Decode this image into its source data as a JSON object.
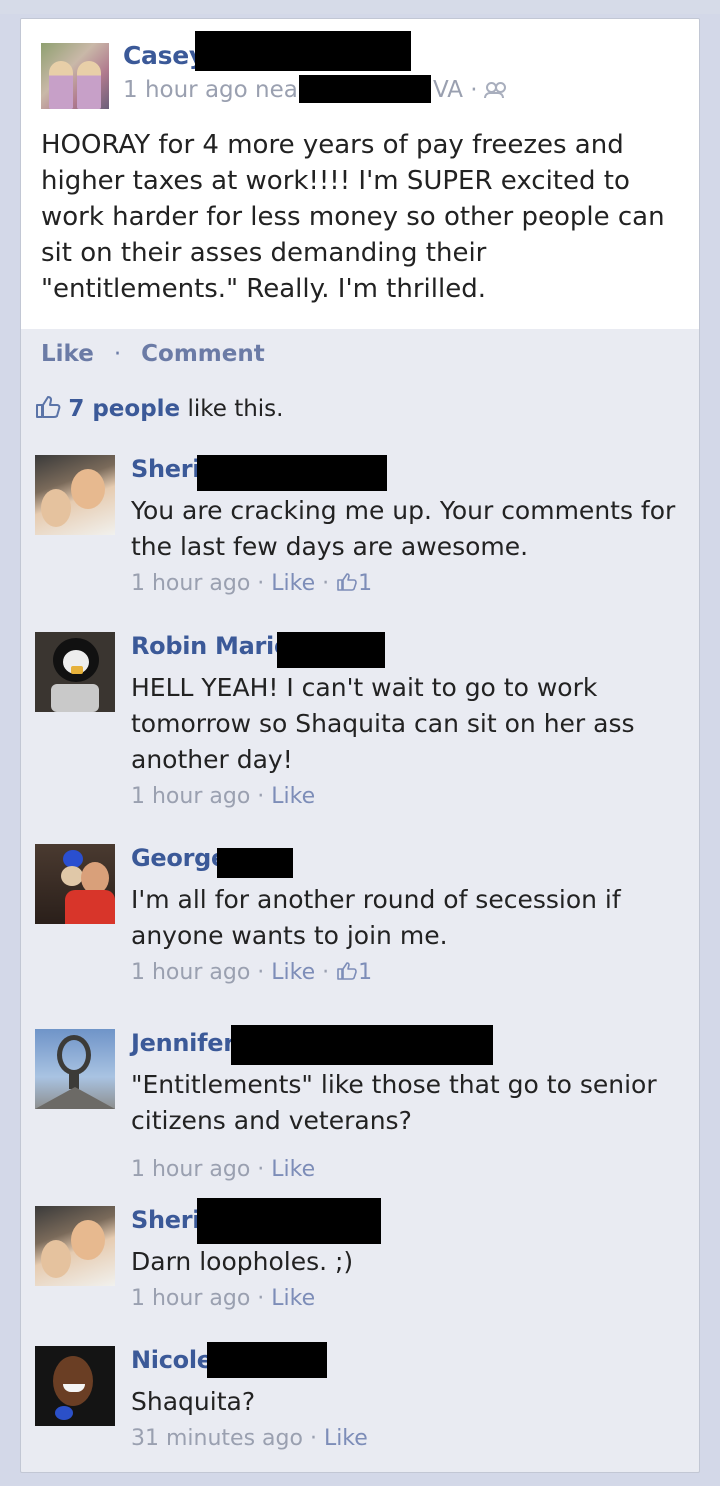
{
  "post": {
    "author": "Casey",
    "time": "1 hour ago near",
    "location_suffix": "VA ·",
    "privacy_icon": "friends-icon",
    "text": "HOORAY for 4 more years of pay freezes and higher taxes at work!!!! I'm SUPER excited to work harder for less money so other people can sit on their asses demanding their \"entitlements.\" Really. I'm thrilled."
  },
  "actions": {
    "like": "Like",
    "separator": "·",
    "comment": "Comment"
  },
  "likes": {
    "icon": "thumbs-up-icon",
    "people": "7 people",
    "suffix": " like this."
  },
  "comments": [
    {
      "name": "Sheri",
      "text": "You are cracking me up. Your comments for the last few days are awesome.",
      "time": "1 hour ago",
      "like": "Like",
      "like_count": "1"
    },
    {
      "name": "Robin Marie",
      "text": "HELL YEAH! I can't wait to go to work tomorrow so Shaquita can sit on her ass another day!",
      "time": "1 hour ago",
      "like": "Like",
      "like_count": ""
    },
    {
      "name": "George",
      "text": "I'm all for another round of secession if anyone wants to join me.",
      "time": "1 hour ago",
      "like": "Like",
      "like_count": "1"
    },
    {
      "name": "Jennifer",
      "text": "\"Entitlements\" like those that go to senior citizens and veterans?",
      "time": "1 hour ago",
      "like": "Like",
      "like_count": ""
    },
    {
      "name": "Sheri",
      "text": "Darn loopholes. ;)",
      "time": "1 hour ago",
      "like": "Like",
      "like_count": ""
    },
    {
      "name": "Nicole",
      "text": "Shaquita?",
      "time": "31 minutes ago",
      "like": "Like",
      "like_count": ""
    }
  ],
  "meta_separator": " · ",
  "colors": {
    "link_blue": "#3b5998",
    "action_blue": "#6b7ba6",
    "meta_gray": "#9aa0b0",
    "background": "#e9ebf2",
    "redaction": "#000000"
  }
}
